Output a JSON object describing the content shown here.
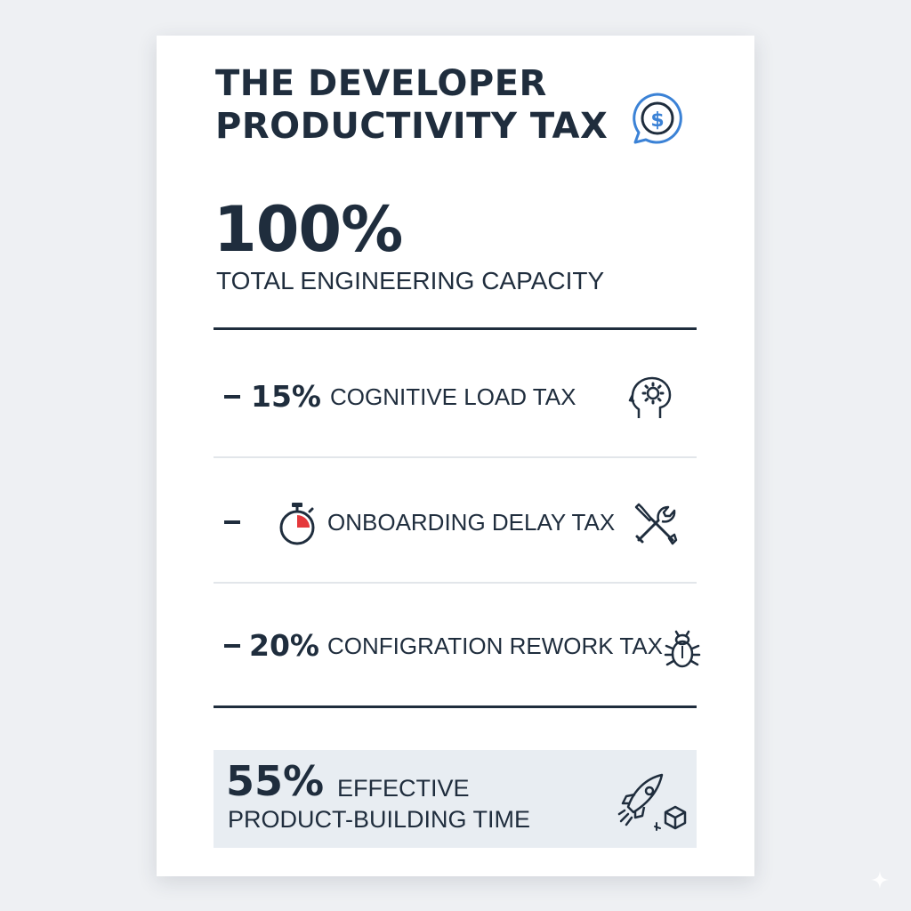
{
  "title": {
    "line1": "THE DEVELOPER",
    "line2": "PRODUCTIVITY TAX",
    "icon": "dollar-chat-icon"
  },
  "capacity": {
    "value": "100%",
    "label": "TOTAL ENGINEERING CAPACITY"
  },
  "taxes": [
    {
      "minus": "–",
      "value": "15%",
      "label": "COGNITIVE LOAD TAX",
      "icon": "brain-gear-icon"
    },
    {
      "minus": "–",
      "value": "",
      "label": "ONBOARDING DELAY TAX",
      "icon": "wrench-screwdriver-icon",
      "inline_icon": "stopwatch-icon"
    },
    {
      "minus": "–",
      "value": "20%",
      "label": "CONFIGRATION REWORK TAX",
      "icon": "bug-icon"
    }
  ],
  "result": {
    "value": "55%",
    "label_line1": "EFFECTIVE",
    "label_line2": "PRODUCT-BUILDING TIME",
    "icon": "rocket-box-icon"
  },
  "colors": {
    "ink": "#1f2d3d",
    "accent_blue": "#3b82d6",
    "timer_red": "#e5383b",
    "result_bg": "#e8edf2"
  }
}
